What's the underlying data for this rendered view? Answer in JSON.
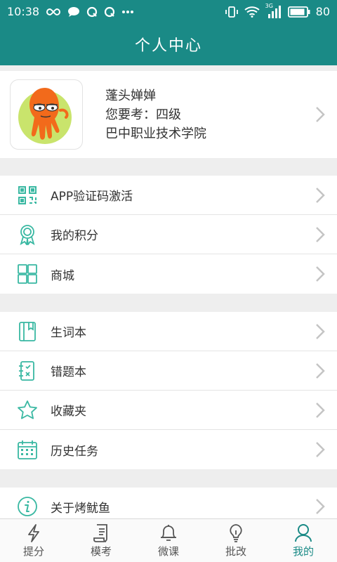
{
  "status_bar": {
    "time": "10:38",
    "battery": "80",
    "network": "3G"
  },
  "header": {
    "title": "个人中心"
  },
  "profile": {
    "name": "蓬头婵婵",
    "exam": "您要考：四级",
    "school": "巴中职业技术学院"
  },
  "menu_groups": [
    [
      {
        "label": "APP验证码激活",
        "icon": "qr-code-icon"
      },
      {
        "label": "我的积分",
        "icon": "award-ribbon-icon"
      },
      {
        "label": "商城",
        "icon": "grid-icon"
      }
    ],
    [
      {
        "label": "生词本",
        "icon": "notebook-icon"
      },
      {
        "label": "错题本",
        "icon": "error-book-icon"
      },
      {
        "label": "收藏夹",
        "icon": "star-icon"
      },
      {
        "label": "历史任务",
        "icon": "calendar-icon"
      }
    ],
    [
      {
        "label": "关于烤鱿鱼",
        "icon": "info-icon"
      }
    ]
  ],
  "tabs": [
    {
      "label": "提分",
      "icon": "lightning-icon"
    },
    {
      "label": "模考",
      "icon": "scroll-icon"
    },
    {
      "label": "微课",
      "icon": "bell-icon"
    },
    {
      "label": "批改",
      "icon": "lightbulb-icon"
    },
    {
      "label": "我的",
      "icon": "person-icon",
      "active": true
    }
  ],
  "colors": {
    "primary": "#1a8a86",
    "icon": "#39b8a2",
    "chevron": "#c4c4c4"
  }
}
